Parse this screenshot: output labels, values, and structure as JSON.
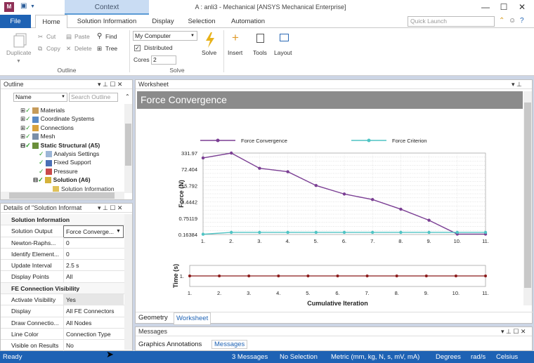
{
  "window": {
    "title": "A : anli3 - Mechanical [ANSYS Mechanical Enterprise]",
    "context_tab": "Context",
    "app_badge": "M",
    "minimize": "—",
    "maximize": "☐",
    "close": "✕"
  },
  "tabs": [
    "File",
    "Home",
    "Solution Information",
    "Display",
    "Selection",
    "Automation"
  ],
  "quick_launch": {
    "placeholder": "Quick Launch"
  },
  "ribbon": {
    "outline": {
      "duplicate": "Duplicate",
      "cut": "Cut",
      "copy": "Copy",
      "paste": "Paste",
      "delete": "Delete",
      "find": "Find",
      "tree": "Tree",
      "group": "Outline"
    },
    "solve": {
      "target": "My Computer",
      "distributed": "Distributed",
      "cores_label": "Cores",
      "cores": "2",
      "solve": "Solve",
      "group": "Solve"
    },
    "insert": "Insert",
    "tools": "Tools",
    "layout": "Layout"
  },
  "outline": {
    "title": "Outline",
    "name_label": "Name",
    "search_placeholder": "Search Outline",
    "items": [
      "Materials",
      "Coordinate Systems",
      "Connections",
      "Mesh",
      "Static Structural (A5)",
      "Analysis Settings",
      "Fixed Support",
      "Pressure",
      "Solution (A6)",
      "Solution Information"
    ]
  },
  "details": {
    "title": "Details of \"Solution Informat",
    "sections": [
      "Solution Information",
      "FE Connection Visibility"
    ],
    "rows": [
      {
        "label": "Solution Output",
        "value": "Force Converge..."
      },
      {
        "label": "Newton-Raphs...",
        "value": "0"
      },
      {
        "label": "Identify Element...",
        "value": "0"
      },
      {
        "label": "Update Interval",
        "value": "2.5 s"
      },
      {
        "label": "Display Points",
        "value": "All"
      },
      {
        "label": "Activate Visibility",
        "value": "Yes"
      },
      {
        "label": "Display",
        "value": "All FE Connectors"
      },
      {
        "label": "Draw Connectio...",
        "value": "All Nodes"
      },
      {
        "label": "Line Color",
        "value": "Connection Type"
      },
      {
        "label": "Visible on Results",
        "value": "No"
      }
    ]
  },
  "worksheet": {
    "title": "Worksheet",
    "header": "Force Convergence",
    "tabs": [
      "Geometry",
      "Worksheet"
    ]
  },
  "messages": {
    "title": "Messages",
    "tabs": [
      "Graphics Annotations",
      "Messages"
    ]
  },
  "status": {
    "ready": "Ready",
    "messages": "3 Messages",
    "selection": "No Selection",
    "units": "Metric (mm, kg, N, s, mV, mA)",
    "angle": "Degrees",
    "rate": "rad/s",
    "temp": "Celsius"
  },
  "colors": {
    "accent": "#1e62b4",
    "force_series": "#7b3f94",
    "criterion_series": "#4fc4c4",
    "time_series": "#8b1a1a",
    "header_bar": "#8b8b8b"
  },
  "chart_data": [
    {
      "type": "line",
      "xlabel": "",
      "ylabel": "Force (N)",
      "log_y": true,
      "x": [
        1,
        2,
        3,
        4,
        5,
        6,
        7,
        8,
        9,
        10,
        11
      ],
      "yticks": [
        "0.16384",
        "0.75119",
        "3.4442",
        "15.792",
        "72.404",
        "331.97"
      ],
      "xticks": [
        "1.",
        "2.",
        "3.",
        "4.",
        "5.",
        "6.",
        "7.",
        "8.",
        "9.",
        "10.",
        "11."
      ],
      "ylim": [
        0.16384,
        331.97
      ],
      "series": [
        {
          "name": "Force Convergence",
          "values": [
            210,
            331.97,
            80,
            58,
            16,
            7.2,
            4.3,
            1.75,
            0.62,
            0.17,
            0.17
          ]
        },
        {
          "name": "Force Criterion",
          "values": [
            0.168,
            0.2,
            0.2,
            0.2,
            0.2,
            0.2,
            0.2,
            0.2,
            0.2,
            0.2,
            0.2
          ]
        }
      ],
      "legend": "top"
    },
    {
      "type": "line",
      "xlabel": "Cumulative Iteration",
      "ylabel": "Time (s)",
      "x": [
        1,
        2,
        3,
        4,
        5,
        6,
        7,
        8,
        9,
        10,
        11
      ],
      "yticks": [
        "1."
      ],
      "xticks": [
        "1.",
        "2.",
        "3.",
        "4.",
        "5.",
        "6.",
        "7.",
        "8.",
        "9.",
        "10.",
        "11."
      ],
      "series": [
        {
          "name": "",
          "values": [
            1,
            1,
            1,
            1,
            1,
            1,
            1,
            1,
            1,
            1,
            1
          ]
        }
      ]
    }
  ]
}
